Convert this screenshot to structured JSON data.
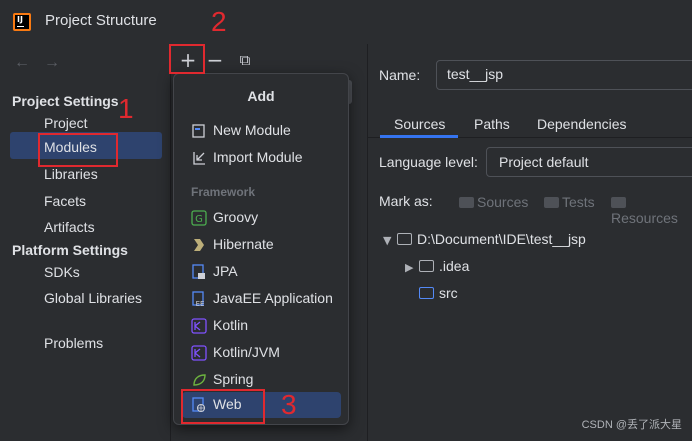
{
  "window": {
    "title": "Project Structure"
  },
  "nav": {
    "back": "←",
    "forward": "→"
  },
  "sidebar": {
    "project_settings_header": "Project Settings",
    "project_items": [
      "Project",
      "Modules",
      "Libraries",
      "Facets",
      "Artifacts"
    ],
    "platform_settings_header": "Platform Settings",
    "platform_items": [
      "SDKs",
      "Global Libraries"
    ],
    "other_items": [
      "Problems"
    ],
    "selected": "Modules"
  },
  "toolbar": {
    "add": "+",
    "remove": "−",
    "copy": "⧉"
  },
  "add_popup": {
    "title": "Add",
    "top_items": [
      {
        "label": "New Module",
        "icon": "new-module-icon"
      },
      {
        "label": "Import Module",
        "icon": "import-module-icon"
      }
    ],
    "framework_header": "Framework",
    "framework_items": [
      {
        "label": "Groovy",
        "icon": "groovy-icon",
        "color": "#4caf50"
      },
      {
        "label": "Hibernate",
        "icon": "hibernate-icon",
        "color": "#bcae79"
      },
      {
        "label": "JPA",
        "icon": "jpa-icon",
        "color": "#548af7"
      },
      {
        "label": "JavaEE Application",
        "icon": "javaee-icon",
        "color": "#548af7"
      },
      {
        "label": "Kotlin",
        "icon": "kotlin-icon",
        "color": "#7f52ff"
      },
      {
        "label": "Kotlin/JVM",
        "icon": "kotlin-jvm-icon",
        "color": "#7f52ff"
      },
      {
        "label": "Spring",
        "icon": "spring-icon",
        "color": "#6db33f"
      },
      {
        "label": "Web",
        "icon": "web-icon",
        "color": "#548af7"
      }
    ],
    "highlighted": "Web"
  },
  "details": {
    "name_label": "Name:",
    "name_value": "test__jsp",
    "tabs": [
      "Sources",
      "Paths",
      "Dependencies"
    ],
    "active_tab": "Sources",
    "language_level_label": "Language level:",
    "language_level_value": "Project default",
    "mark_as_label": "Mark as:",
    "mark_as_buttons": [
      "Sources",
      "Tests",
      "Resources"
    ],
    "tree": {
      "root": "D:\\Document\\IDE\\test__jsp",
      "children": [
        ".idea",
        "src"
      ]
    }
  },
  "annotations": {
    "step1": "1",
    "step2": "2",
    "step3": "3",
    "color": "#e0292f"
  },
  "watermark": "CSDN @丢了派大星"
}
